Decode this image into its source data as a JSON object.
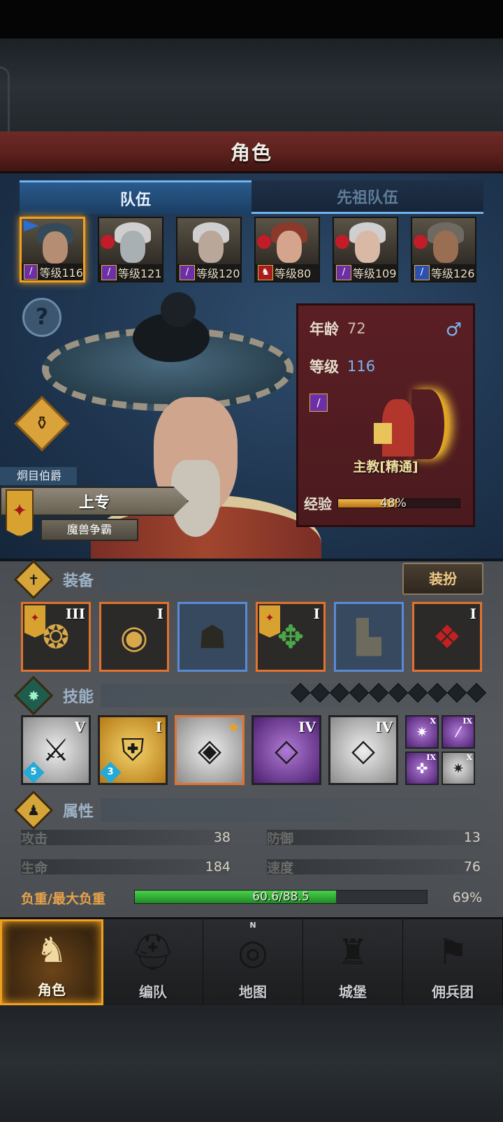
{
  "header": {
    "title": "角色"
  },
  "tabs": [
    {
      "label": "队伍",
      "active": true
    },
    {
      "label": "先祖队伍",
      "active": false
    }
  ],
  "roster": [
    {
      "level_label": "等级116",
      "class_icon": "staff-icon",
      "selected": true
    },
    {
      "level_label": "等级121",
      "class_icon": "staff-icon",
      "selected": false
    },
    {
      "level_label": "等级120",
      "class_icon": "staff-icon",
      "selected": false
    },
    {
      "level_label": "等级80",
      "class_icon": "beast-icon",
      "selected": false
    },
    {
      "level_label": "等级109",
      "class_icon": "staff-icon",
      "selected": false
    },
    {
      "level_label": "等级126",
      "class_icon": "sword-icon",
      "selected": false
    }
  ],
  "hero": {
    "title_tag": "炯目伯爵",
    "rank": "上专",
    "faction": "魔兽争霸",
    "age_label": "年龄",
    "age": "72",
    "level_label": "等级",
    "level": "116",
    "gender_symbol": "♂",
    "class_name": "主教[精通]",
    "exp_label": "经验",
    "exp_percent_text": "48%",
    "exp_fraction": 0.48
  },
  "sections": {
    "equipment": "装备",
    "dress_button": "装扮",
    "skills": "技能",
    "attributes": "属性"
  },
  "equipment": [
    {
      "icon": "shoulder-armor-icon",
      "roman": "III",
      "rarity": "orange",
      "banner": true
    },
    {
      "icon": "tome-icon",
      "roman": "I",
      "rarity": "orange",
      "banner": false
    },
    {
      "icon": "hood-icon",
      "roman": "",
      "rarity": "blue",
      "banner": false
    },
    {
      "icon": "chest-armor-icon",
      "roman": "I",
      "rarity": "orange",
      "banner": true
    },
    {
      "icon": "boots-icon",
      "roman": "",
      "rarity": "blue",
      "banner": false
    },
    {
      "icon": "charm-knot-icon",
      "roman": "I",
      "rarity": "orange",
      "banner": false
    }
  ],
  "skill_slots": 10,
  "skills": [
    {
      "icon": "spear-aura-icon",
      "roman": "V",
      "style": "gray",
      "count": "5"
    },
    {
      "icon": "heal-shield-icon",
      "roman": "I",
      "style": "gold",
      "count": "3"
    },
    {
      "icon": "crystal-heal-icon",
      "roman": "",
      "style": "gray",
      "star": true,
      "selected": true
    },
    {
      "icon": "crystal-hand-icon",
      "roman": "IV",
      "style": "purple"
    },
    {
      "icon": "crystal-hand-icon",
      "roman": "IV",
      "style": "gray"
    }
  ],
  "mini_skills": [
    {
      "icon": "burst-icon",
      "roman": "X",
      "style": "purple"
    },
    {
      "icon": "wand-icon",
      "roman": "IX",
      "style": "purple"
    },
    {
      "icon": "target-icon",
      "roman": "IX",
      "style": "purple"
    },
    {
      "icon": "burst-icon",
      "roman": "X",
      "style": "gray"
    }
  ],
  "stats": {
    "attack_label": "攻击",
    "attack": "38",
    "defense_label": "防御",
    "defense": "13",
    "hp_label": "生命",
    "hp": "184",
    "speed_label": "速度",
    "speed": "76",
    "load_label": "负重/最大负重",
    "load_text": "60.6/88.5",
    "load_percent": "69%",
    "load_fraction": 0.69
  },
  "nav": [
    {
      "label": "角色",
      "icon": "knight-icon",
      "active": true
    },
    {
      "label": "编队",
      "icon": "helmet-icon",
      "active": false
    },
    {
      "label": "地图",
      "icon": "compass-map-icon",
      "active": false,
      "compass_n": "N"
    },
    {
      "label": "城堡",
      "icon": "castle-icon",
      "active": false
    },
    {
      "label": "佣兵团",
      "icon": "mercenary-icon",
      "active": false
    }
  ],
  "colors": {
    "accent_orange": "#f0a020",
    "tab_active": "#2a5a8c",
    "banner_red": "#6e2a26",
    "load_green": "#4ad14a",
    "exp_gold": "#f3b64a"
  }
}
